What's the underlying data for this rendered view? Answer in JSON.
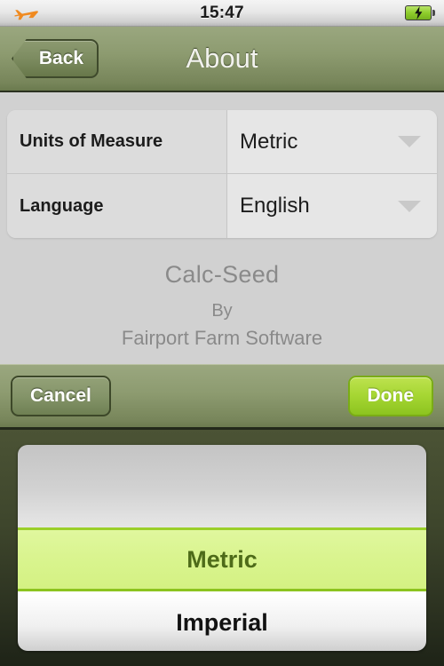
{
  "status_bar": {
    "airplane_icon": "airplane-icon",
    "time": "15:47",
    "battery_icon": "battery-charging-icon"
  },
  "nav_bar": {
    "back_label": "Back",
    "title": "About"
  },
  "settings": {
    "rows": [
      {
        "label": "Units of Measure",
        "value": "Metric",
        "chevron": "chevron-down-icon"
      },
      {
        "label": "Language",
        "value": "English",
        "chevron": "chevron-down-icon"
      }
    ]
  },
  "about": {
    "app_name": "Calc-Seed",
    "by": "By",
    "company": "Fairport Farm Software"
  },
  "toolbar": {
    "cancel_label": "Cancel",
    "done_label": "Done"
  },
  "picker": {
    "selected_option": "Metric",
    "next_option": "Imperial"
  },
  "colors": {
    "nav_green_top": "#9aa77f",
    "nav_green_bottom": "#6a7a4e",
    "done_green": "#a6d633",
    "picker_highlight": "#d9f48e",
    "picker_highlight_text": "#4e6b19",
    "picker_backdrop": "#3e462c",
    "content_bg": "#d1d1d1",
    "battery_green": "#8fce2c",
    "airplane_orange": "#f08a20"
  }
}
